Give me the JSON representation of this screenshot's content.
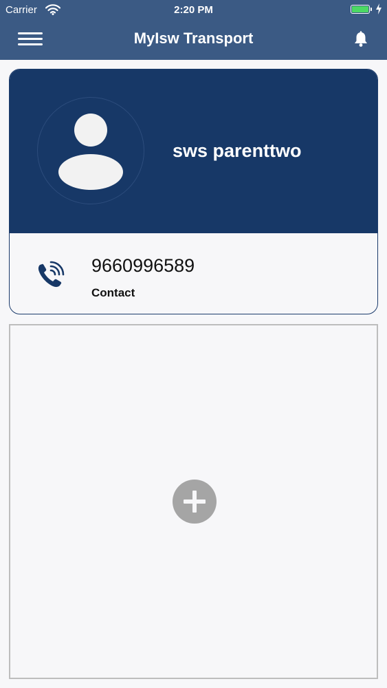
{
  "status_bar": {
    "carrier": "Carrier",
    "time": "2:20 PM",
    "battery_color": "#4cd964"
  },
  "header": {
    "title": "MyIsw Transport",
    "menu_icon": "hamburger-menu-icon",
    "bell_icon": "bell-icon",
    "background_color": "#3b5a84"
  },
  "profile": {
    "name": "sws parenttwo",
    "avatar_icon": "user-avatar-icon",
    "card_color": "#173867",
    "contact": {
      "number": "9660996589",
      "label": "Contact",
      "icon": "phone-ringing-icon"
    }
  },
  "add_panel": {
    "icon": "plus-circle-icon",
    "button_color": "#a5a5a5"
  }
}
